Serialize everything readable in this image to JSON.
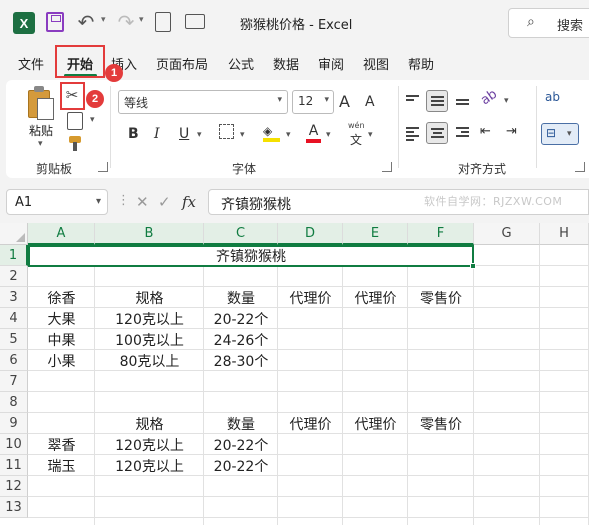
{
  "app": {
    "title": "猕猴桃价格  -  Excel",
    "search_label": "搜索",
    "search_icon": "search-icon"
  },
  "quick_access": {
    "logo": "X",
    "undo_icon": "undo-icon",
    "redo_icon": "redo-icon"
  },
  "menu": {
    "tabs": [
      "文件",
      "开始",
      "插入",
      "页面布局",
      "公式",
      "数据",
      "审阅",
      "视图",
      "帮助"
    ],
    "active_tab": "开始"
  },
  "annotations": {
    "badge1": "1",
    "badge2": "2",
    "highlight_color": "#e33b3b"
  },
  "ribbon": {
    "clipboard": {
      "label": "剪贴板",
      "paste_label": "粘贴",
      "cut_icon": "✂",
      "copy_icon": "copy-icon",
      "format_painter_icon": "format-painter-icon"
    },
    "font": {
      "label": "字体",
      "font_name": "等线",
      "font_size": "12",
      "grow_label": "A",
      "shrink_label": "A",
      "bold_label": "B",
      "italic_label": "I",
      "underline_label": "U",
      "font_color_label": "A",
      "wen_label": "wén",
      "wen_char": "文"
    },
    "alignment": {
      "label": "对齐方式",
      "wrap_label": "ab"
    }
  },
  "formula_bar": {
    "name_box": "A1",
    "fx_label": "fx",
    "formula": "齐镇猕猴桃",
    "watermark": "软件自学网：RJZXW.COM"
  },
  "sheet": {
    "columns": [
      "A",
      "B",
      "C",
      "D",
      "E",
      "F",
      "G",
      "H"
    ],
    "rows": [
      "1",
      "2",
      "3",
      "4",
      "5",
      "6",
      "7",
      "8",
      "9",
      "10",
      "11",
      "12",
      "13"
    ],
    "selected_cell": "A1",
    "title_cell": "齐镇猕猴桃",
    "accent_color": "#107c41",
    "cells": [
      {
        "row": 3,
        "col": "A",
        "text": "徐香"
      },
      {
        "row": 3,
        "col": "B",
        "text": "规格"
      },
      {
        "row": 3,
        "col": "C",
        "text": "数量"
      },
      {
        "row": 3,
        "col": "D",
        "text": "代理价"
      },
      {
        "row": 3,
        "col": "E",
        "text": "代理价"
      },
      {
        "row": 3,
        "col": "F",
        "text": "零售价"
      },
      {
        "row": 4,
        "col": "A",
        "text": "大果"
      },
      {
        "row": 4,
        "col": "B",
        "text": "120克以上"
      },
      {
        "row": 4,
        "col": "C",
        "text": "20-22个"
      },
      {
        "row": 5,
        "col": "A",
        "text": "中果"
      },
      {
        "row": 5,
        "col": "B",
        "text": "100克以上"
      },
      {
        "row": 5,
        "col": "C",
        "text": "24-26个"
      },
      {
        "row": 6,
        "col": "A",
        "text": "小果"
      },
      {
        "row": 6,
        "col": "B",
        "text": "80克以上"
      },
      {
        "row": 6,
        "col": "C",
        "text": "28-30个"
      },
      {
        "row": 9,
        "col": "B",
        "text": "规格"
      },
      {
        "row": 9,
        "col": "C",
        "text": "数量"
      },
      {
        "row": 9,
        "col": "D",
        "text": "代理价"
      },
      {
        "row": 9,
        "col": "E",
        "text": "代理价"
      },
      {
        "row": 9,
        "col": "F",
        "text": "零售价"
      },
      {
        "row": 10,
        "col": "A",
        "text": "翠香"
      },
      {
        "row": 10,
        "col": "B",
        "text": "120克以上"
      },
      {
        "row": 10,
        "col": "C",
        "text": "20-22个"
      },
      {
        "row": 11,
        "col": "A",
        "text": "瑞玉"
      },
      {
        "row": 11,
        "col": "B",
        "text": "120克以上"
      },
      {
        "row": 11,
        "col": "C",
        "text": "20-22个"
      }
    ]
  }
}
